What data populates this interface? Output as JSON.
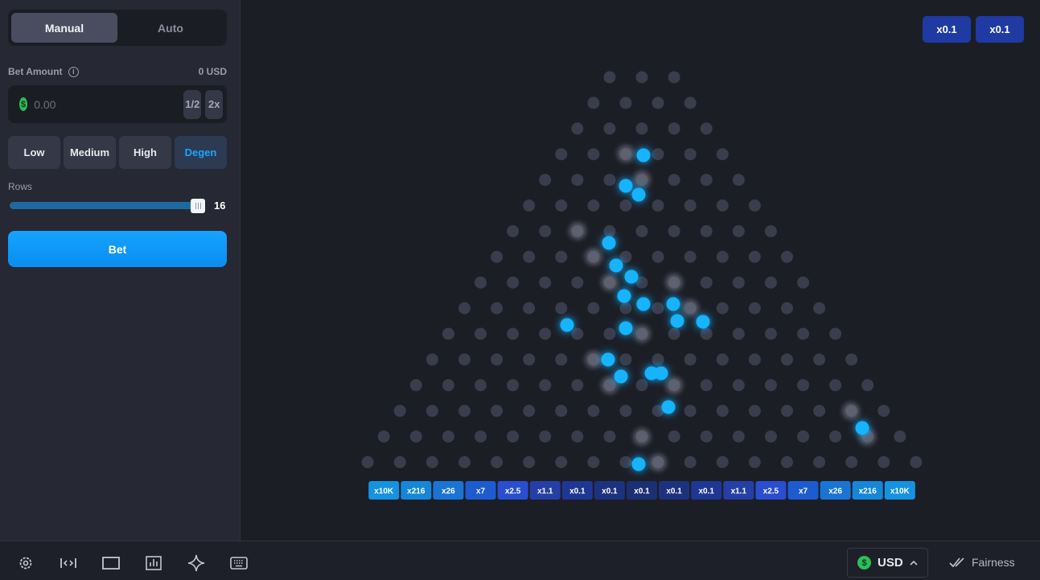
{
  "sidebar": {
    "modes": [
      "Manual",
      "Auto"
    ],
    "active_mode": "Manual",
    "bet_amount_label": "Bet Amount",
    "bet_amount_usd": "0 USD",
    "amount_placeholder": "0.00",
    "half_label": "1/2",
    "double_label": "2x",
    "risk_levels": [
      "Low",
      "Medium",
      "High",
      "Degen"
    ],
    "selected_risk": "Degen",
    "rows_label": "Rows",
    "rows_value": "16",
    "rows_fill": 1.0,
    "bet_button": "Bet"
  },
  "history": [
    "x0.1",
    "x0.1"
  ],
  "multipliers": [
    {
      "label": "x10K",
      "color": "#1592e0"
    },
    {
      "label": "x216",
      "color": "#1686d8"
    },
    {
      "label": "x26",
      "color": "#1a74d3"
    },
    {
      "label": "x7",
      "color": "#1d5bd0"
    },
    {
      "label": "x2.5",
      "color": "#2a4ed0"
    },
    {
      "label": "x1.1",
      "color": "#253fa6"
    },
    {
      "label": "x0.1",
      "color": "#1f3794"
    },
    {
      "label": "x0.1",
      "color": "#1d327f"
    },
    {
      "label": "x0.1",
      "color": "#1c2f72"
    },
    {
      "label": "x0.1",
      "color": "#1d327f"
    },
    {
      "label": "x0.1",
      "color": "#1f3794"
    },
    {
      "label": "x1.1",
      "color": "#253fa6"
    },
    {
      "label": "x2.5",
      "color": "#2a4ed0"
    },
    {
      "label": "x7",
      "color": "#1d5bd0"
    },
    {
      "label": "x26",
      "color": "#1a74d3"
    },
    {
      "label": "x216",
      "color": "#1686d8"
    },
    {
      "label": "x10K",
      "color": "#1592e0"
    }
  ],
  "bottom": {
    "tools": [
      "gear-icon",
      "expand-icon",
      "theater-icon",
      "stats-icon",
      "sparkle-icon",
      "keyboard-icon"
    ],
    "currency": "USD",
    "fairness": "Fairness"
  },
  "colors": {
    "accent": "#0a9cff",
    "ball": "#19b3ff",
    "peg": "#3a3d4b"
  }
}
